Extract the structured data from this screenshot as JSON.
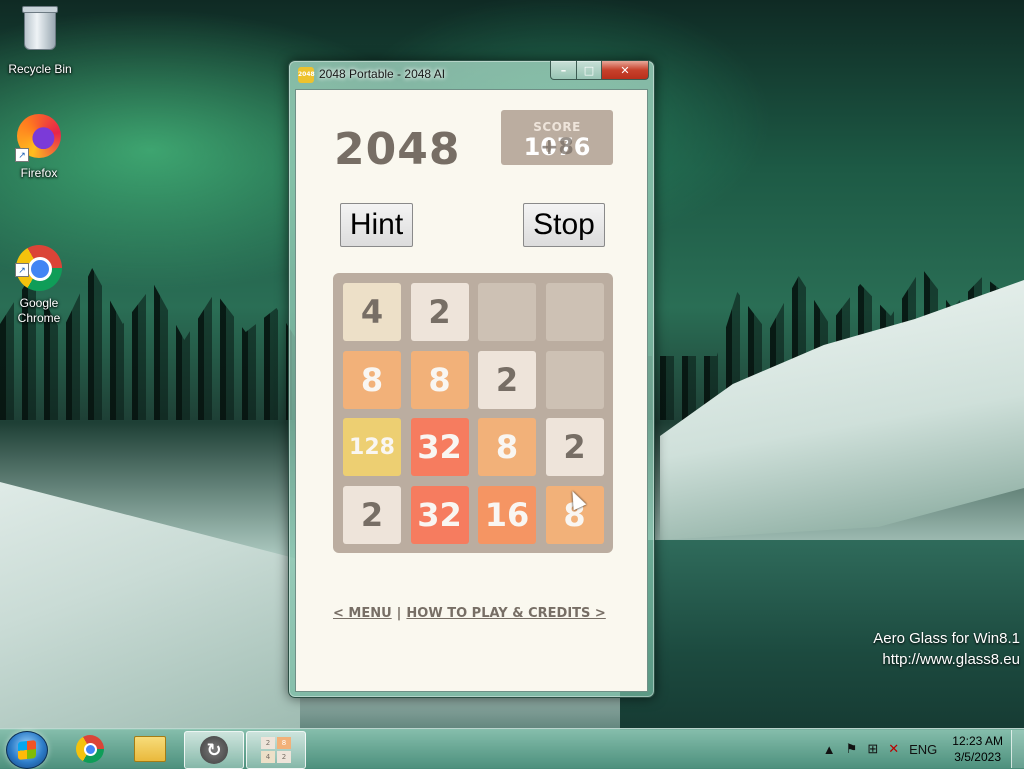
{
  "desktop": {
    "icons": [
      {
        "label": "Recycle Bin",
        "icon": "recycle-bin-icon"
      },
      {
        "label": "Firefox",
        "icon": "firefox-icon"
      },
      {
        "label": "Google\nChrome",
        "icon": "chrome-icon"
      }
    ],
    "watermark": {
      "line1": "Aero Glass for Win8.1",
      "line2": "http://www.glass8.eu"
    }
  },
  "window": {
    "title": "2048 Portable - 2048 AI",
    "icon_text": "2048",
    "caption": {
      "minimize": "–",
      "maximize": "□",
      "close": "✕"
    }
  },
  "game": {
    "title": "2048",
    "score_label": "SCORE",
    "score": "1076",
    "score_increment": "+8",
    "hint_label": "Hint",
    "stop_label": "Stop",
    "grid": [
      [
        4,
        2,
        null,
        null
      ],
      [
        8,
        8,
        2,
        null
      ],
      [
        128,
        32,
        8,
        2
      ],
      [
        2,
        32,
        16,
        8
      ]
    ],
    "menu_link": "< MENU",
    "separator": "|",
    "howto_link": "HOW TO PLAY & CREDITS >"
  },
  "colors": {
    "board": "#bbada0",
    "empty": "#cdc1b4",
    "t2": "#eee4da",
    "t4": "#ede0c8",
    "t8": "#f2b179",
    "t16": "#f59563",
    "t32": "#f67c5f",
    "t128": "#edcf72",
    "text_dark": "#776e65",
    "text_light": "#f9f6f2"
  },
  "taskbar": {
    "items": [
      "Google Chrome",
      "File Explorer",
      "App",
      "2048 Portable"
    ],
    "mini_tiles": [
      "2",
      "8",
      "4",
      "2"
    ],
    "tray": {
      "language": "ENG",
      "time": "12:23 AM",
      "date": "3/5/2023"
    }
  }
}
